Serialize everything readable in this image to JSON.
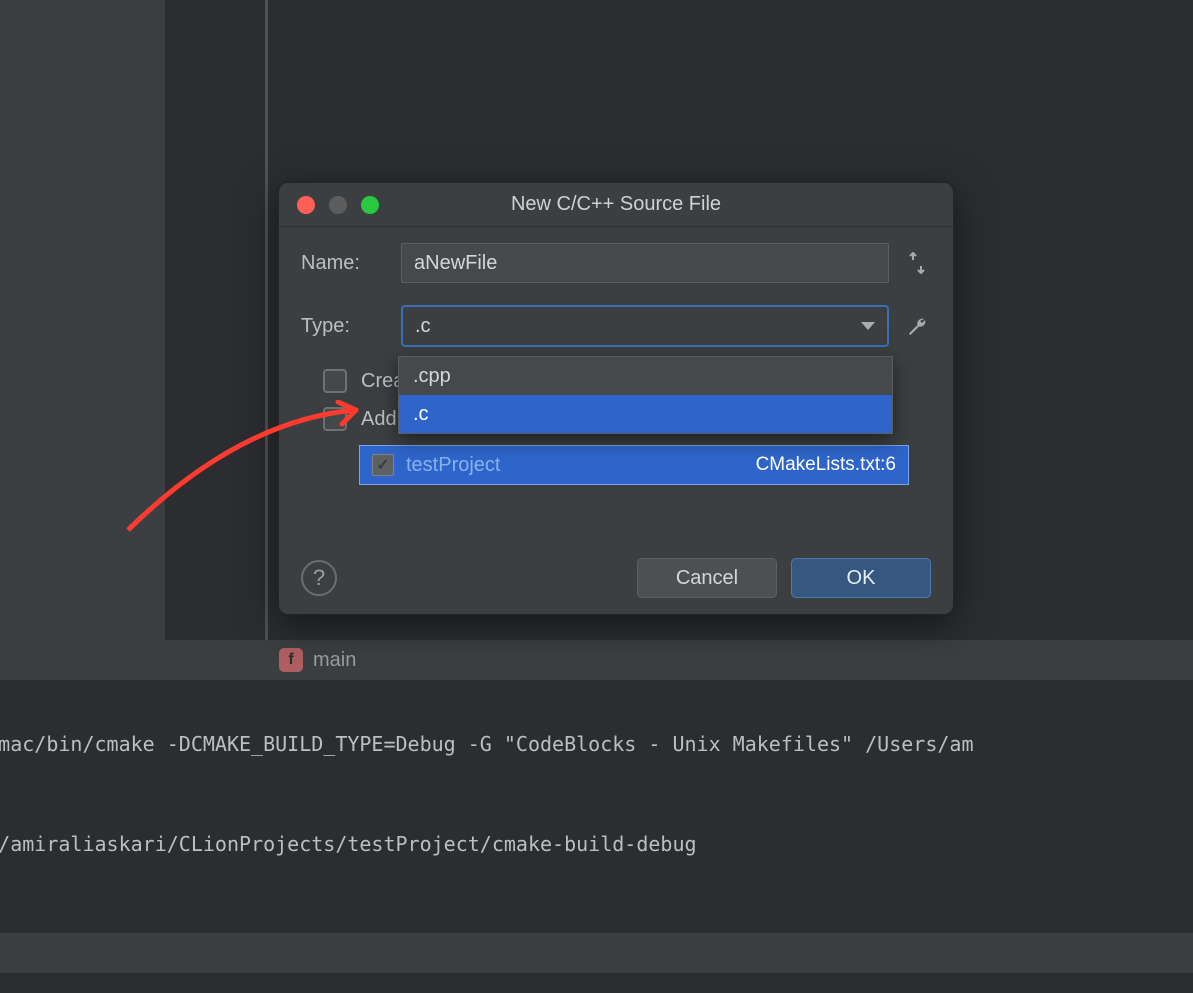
{
  "dialog": {
    "title": "New C/C++ Source File",
    "name_label": "Name:",
    "name_value": "aNewFile",
    "type_label": "Type:",
    "type_value": ".c",
    "type_options": [
      ".cpp",
      ".c"
    ],
    "checkbox1_label": "Crea",
    "checkbox2_label": "Add",
    "target": {
      "name": "testProject",
      "detail": "CMakeLists.txt:6",
      "checked": true
    },
    "help_label": "?",
    "cancel_label": "Cancel",
    "ok_label": "OK"
  },
  "breadcrumb": {
    "badge": "f",
    "text": "main"
  },
  "console": {
    "line1": "ake/mac/bin/cmake -DCMAKE_BUILD_TYPE=Debug -G \"CodeBlocks - Unix Makefiles\" /Users/am",
    "line2": "sers/amiraliaskari/CLionProjects/testProject/cmake-build-debug"
  },
  "icons": {
    "updown": "↑↓",
    "wrench": "wrench"
  }
}
